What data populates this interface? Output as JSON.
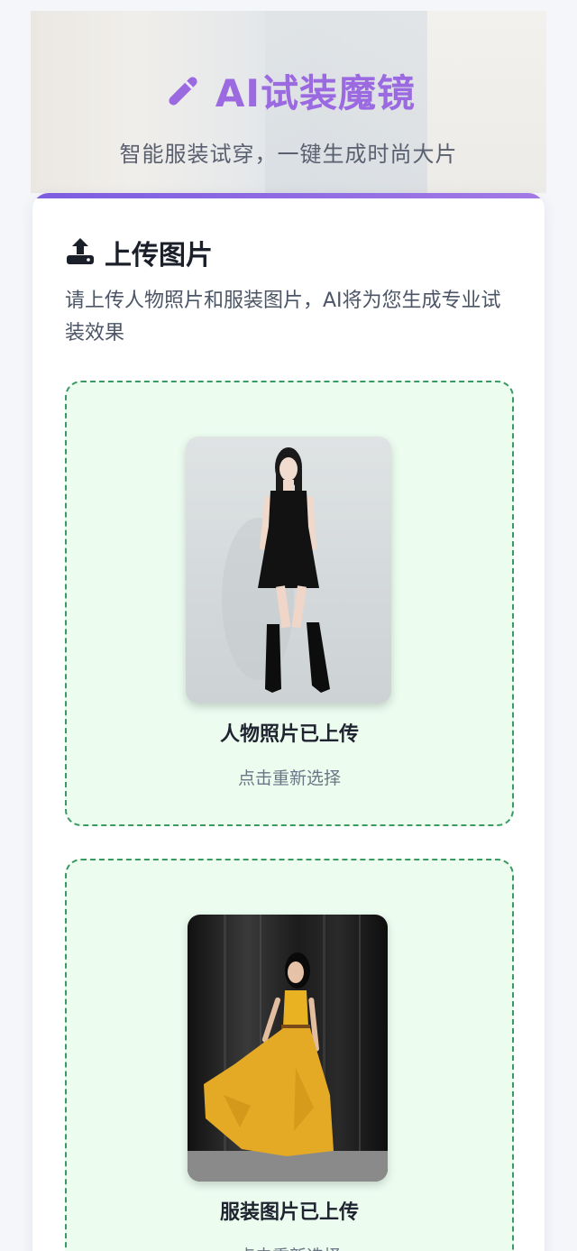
{
  "header": {
    "title": "AI试装魔镜",
    "subtitle": "智能服装试穿，一键生成时尚大片",
    "icon": "magic-wand-icon"
  },
  "upload_section": {
    "title": "上传图片",
    "icon": "upload-icon",
    "description": "请上传人物照片和服装图片，AI将为您生成专业试装效果"
  },
  "person_upload": {
    "status": "人物照片已上传",
    "hint": "点击重新选择",
    "image_alt": "person-photo"
  },
  "garment_upload": {
    "status": "服装图片已上传",
    "hint": "点击重新选择",
    "image_alt": "garment-photo"
  },
  "colors": {
    "accent": "#9b6ae0",
    "dashed_border": "#3a9a63",
    "upload_bg": "#ecfdf0",
    "card_bar": "#7c5de0"
  }
}
